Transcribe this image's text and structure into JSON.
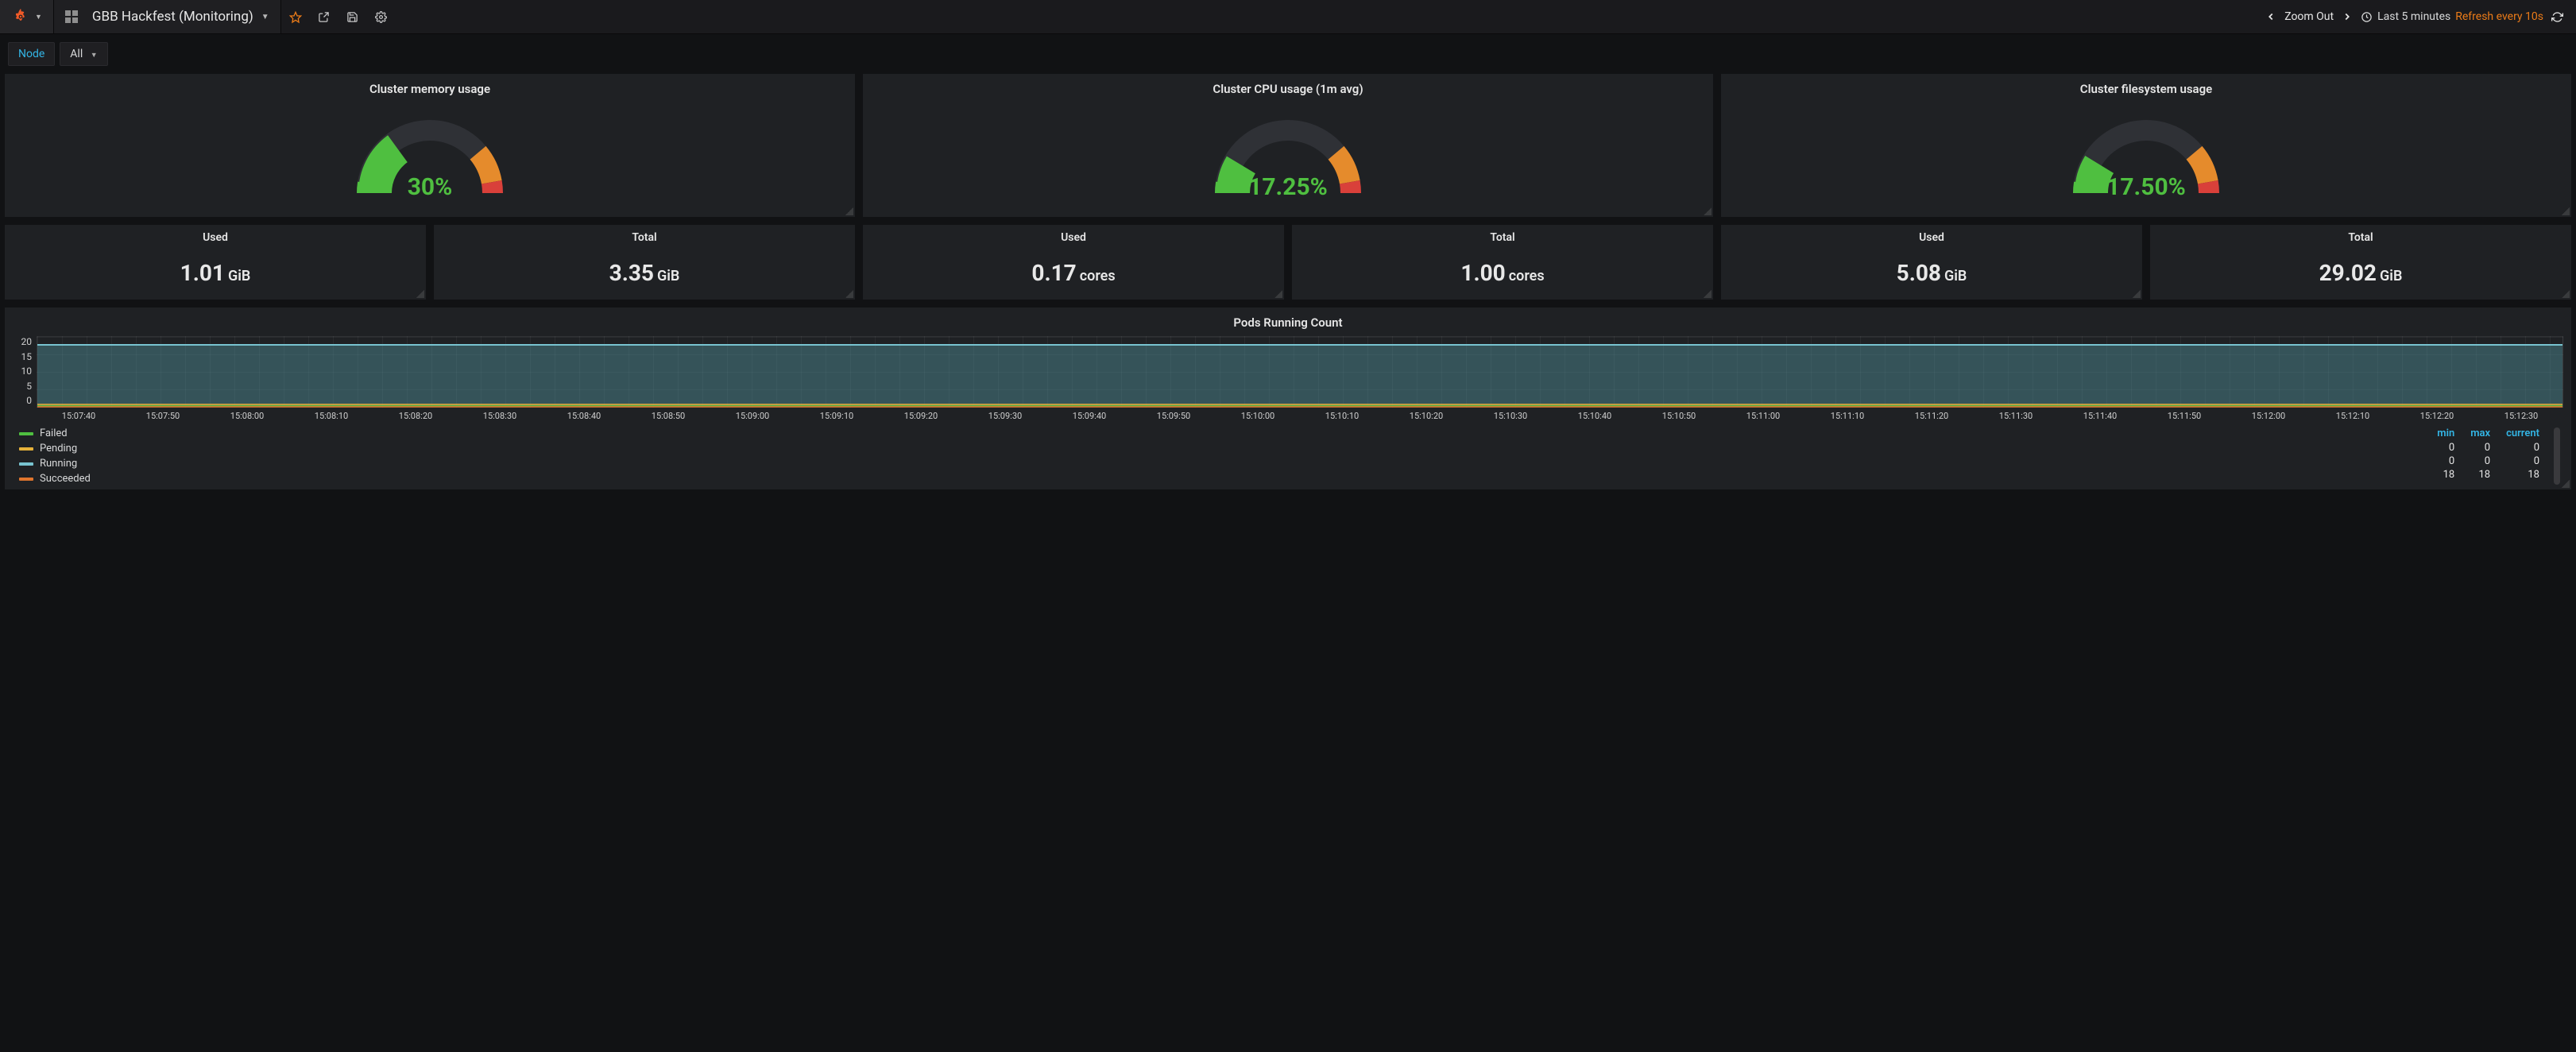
{
  "header": {
    "dashboard_title": "GBB Hackfest (Monitoring)",
    "zoom_out": "Zoom Out",
    "time_range": "Last 5 minutes",
    "refresh": "Refresh every 10s"
  },
  "vars": {
    "label": "Node",
    "value": "All"
  },
  "gauges": [
    {
      "title": "Cluster memory usage",
      "value": "30%",
      "pct": 30
    },
    {
      "title": "Cluster CPU usage (1m avg)",
      "value": "17.25%",
      "pct": 17.25
    },
    {
      "title": "Cluster filesystem usage",
      "value": "17.50%",
      "pct": 17.5
    }
  ],
  "stats": [
    {
      "title": "Used",
      "value": "1.01",
      "unit": "GiB"
    },
    {
      "title": "Total",
      "value": "3.35",
      "unit": "GiB"
    },
    {
      "title": "Used",
      "value": "0.17",
      "unit": "cores"
    },
    {
      "title": "Total",
      "value": "1.00",
      "unit": "cores"
    },
    {
      "title": "Used",
      "value": "5.08",
      "unit": "GiB"
    },
    {
      "title": "Total",
      "value": "29.02",
      "unit": "GiB"
    }
  ],
  "pods": {
    "title": "Pods Running Count",
    "y_ticks": [
      "20",
      "15",
      "10",
      "5",
      "0"
    ],
    "x_ticks": [
      "15:07:40",
      "15:07:50",
      "15:08:00",
      "15:08:10",
      "15:08:20",
      "15:08:30",
      "15:08:40",
      "15:08:50",
      "15:09:00",
      "15:09:10",
      "15:09:20",
      "15:09:30",
      "15:09:40",
      "15:09:50",
      "15:10:00",
      "15:10:10",
      "15:10:20",
      "15:10:30",
      "15:10:40",
      "15:10:50",
      "15:11:00",
      "15:11:10",
      "15:11:20",
      "15:11:30",
      "15:11:40",
      "15:11:50",
      "15:12:00",
      "15:12:10",
      "15:12:20",
      "15:12:30"
    ],
    "legend_headers": [
      "min",
      "max",
      "current"
    ],
    "series": [
      {
        "name": "Failed",
        "color": "#4fbf40",
        "min": "0",
        "max": "0",
        "current": "0"
      },
      {
        "name": "Pending",
        "color": "#e6b23a",
        "min": "0",
        "max": "0",
        "current": "0"
      },
      {
        "name": "Running",
        "color": "#78c3d0",
        "min": "18",
        "max": "18",
        "current": "18"
      },
      {
        "name": "Succeeded",
        "color": "#e0752d",
        "min": "",
        "max": "",
        "current": ""
      }
    ]
  },
  "chart_data": {
    "type": "line",
    "title": "Pods Running Count",
    "ylim": [
      0,
      20
    ],
    "x": [
      "15:07:40",
      "15:07:50",
      "15:08:00",
      "15:08:10",
      "15:08:20",
      "15:08:30",
      "15:08:40",
      "15:08:50",
      "15:09:00",
      "15:09:10",
      "15:09:20",
      "15:09:30",
      "15:09:40",
      "15:09:50",
      "15:10:00",
      "15:10:10",
      "15:10:20",
      "15:10:30",
      "15:10:40",
      "15:10:50",
      "15:11:00",
      "15:11:10",
      "15:11:20",
      "15:11:30",
      "15:11:40",
      "15:11:50",
      "15:12:00",
      "15:12:10",
      "15:12:20",
      "15:12:30"
    ],
    "series": [
      {
        "name": "Failed",
        "values": [
          0,
          0,
          0,
          0,
          0,
          0,
          0,
          0,
          0,
          0,
          0,
          0,
          0,
          0,
          0,
          0,
          0,
          0,
          0,
          0,
          0,
          0,
          0,
          0,
          0,
          0,
          0,
          0,
          0,
          0
        ]
      },
      {
        "name": "Pending",
        "values": [
          0,
          0,
          0,
          0,
          0,
          0,
          0,
          0,
          0,
          0,
          0,
          0,
          0,
          0,
          0,
          0,
          0,
          0,
          0,
          0,
          0,
          0,
          0,
          0,
          0,
          0,
          0,
          0,
          0,
          0
        ]
      },
      {
        "name": "Running",
        "values": [
          18,
          18,
          18,
          18,
          18,
          18,
          18,
          18,
          18,
          18,
          18,
          18,
          18,
          18,
          18,
          18,
          18,
          18,
          18,
          18,
          18,
          18,
          18,
          18,
          18,
          18,
          18,
          18,
          18,
          18
        ]
      },
      {
        "name": "Succeeded",
        "values": [
          0,
          0,
          0,
          0,
          0,
          0,
          0,
          0,
          0,
          0,
          0,
          0,
          0,
          0,
          0,
          0,
          0,
          0,
          0,
          0,
          0,
          0,
          0,
          0,
          0,
          0,
          0,
          0,
          0,
          0
        ]
      }
    ]
  }
}
